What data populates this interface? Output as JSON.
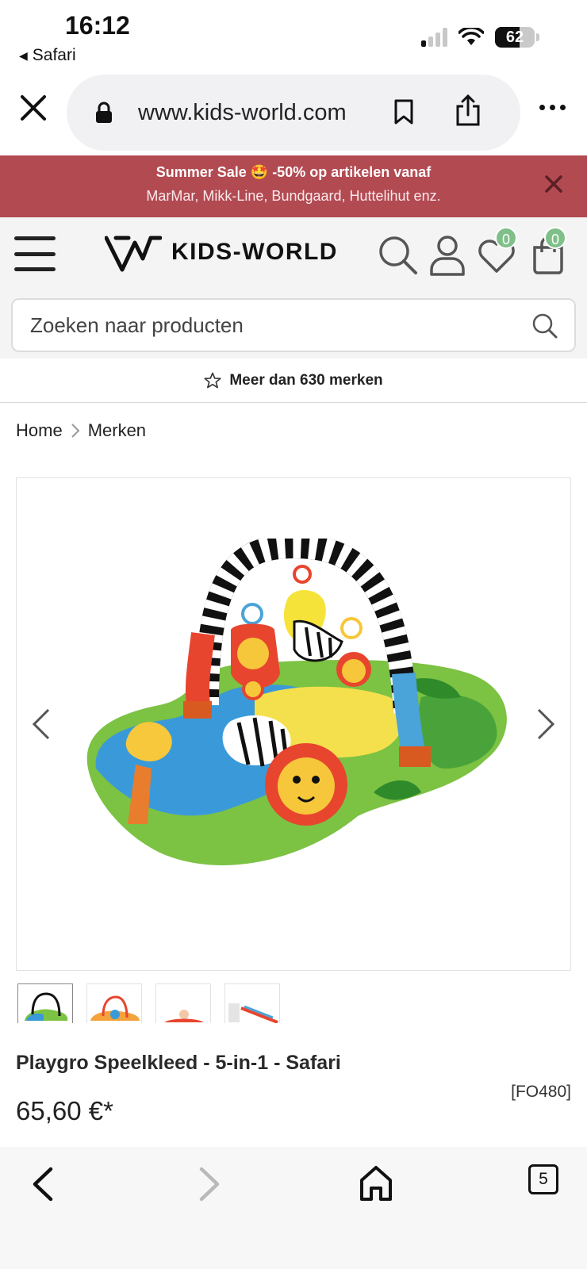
{
  "status_bar": {
    "time": "16:12",
    "back_app": "Safari",
    "battery": "62",
    "battery_level": 0.62
  },
  "browser": {
    "url": "www.kids-world.com",
    "open_tabs": "5"
  },
  "promo": {
    "line1": "Summer Sale 🤩 -50% op artikelen vanaf",
    "line2": "MarMar, Mikk-Line, Bundgaard, Huttelihut enz."
  },
  "header": {
    "logo_text": "KIDS-WORLD",
    "wishlist_count": "0",
    "cart_count": "0"
  },
  "search": {
    "placeholder": "Zoeken naar producten"
  },
  "usp": {
    "text": "Meer dan 630 merken"
  },
  "breadcrumb": {
    "items": [
      "Home",
      "Merken"
    ]
  },
  "product": {
    "title": "Playgro Speelkleed - 5-in-1 - Safari",
    "sku": "[FO480]",
    "price": "65,60 €*",
    "thumbnail_count": 4
  },
  "colors": {
    "promo_bg": "#b24a52",
    "badge": "#7fbf8a",
    "header_bg": "#f4f4f4"
  },
  "icons": [
    "close-icon",
    "lock-icon",
    "bookmark-icon",
    "share-icon",
    "more-icon",
    "menu-icon",
    "search-icon",
    "account-icon",
    "heart-icon",
    "cart-icon",
    "star-icon",
    "chevron-left-icon",
    "chevron-right-icon",
    "home-icon",
    "tabs-icon"
  ]
}
